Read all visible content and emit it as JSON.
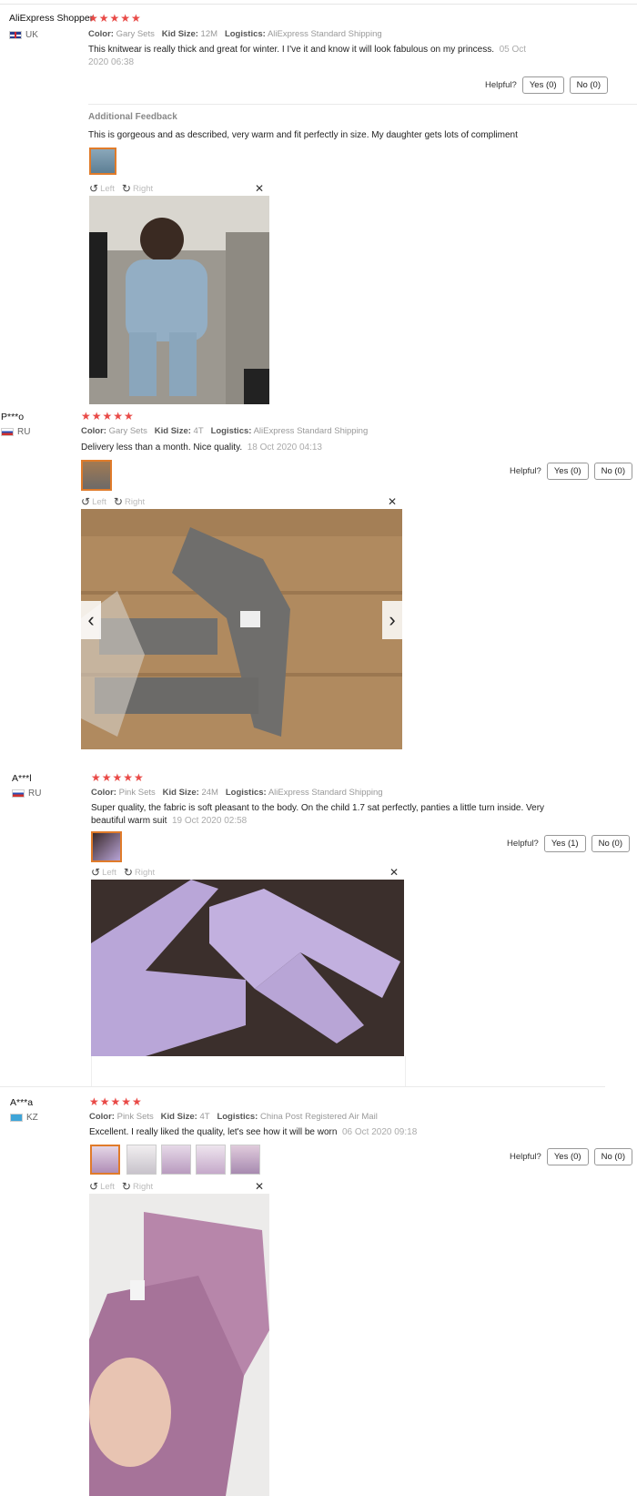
{
  "helpful_label": "Helpful?",
  "left_label": "Left",
  "right_label": "Right",
  "reviews": [
    {
      "user": "AliExpress Shopper",
      "country": "UK",
      "stars": "★★★★★",
      "color_label": "Color:",
      "color": "Gary Sets",
      "size_label": "Kid Size:",
      "size": "12M",
      "logistics_label": "Logistics:",
      "logistics": "AliExpress Standard Shipping",
      "text": "This knitwear is really thick and great for winter. I I've it and know it will look fabulous on my princess.",
      "date": "05 Oct 2020 06:38",
      "yes": "Yes (0)",
      "no": "No (0)",
      "additional_title": "Additional Feedback",
      "additional_text": "This is gorgeous and as described, very warm and fit perfectly in size. My daughter gets lots of compliment"
    },
    {
      "user": "P***o",
      "country": "RU",
      "stars": "★★★★★",
      "color_label": "Color:",
      "color": "Gary Sets",
      "size_label": "Kid Size:",
      "size": "4T",
      "logistics_label": "Logistics:",
      "logistics": "AliExpress Standard Shipping",
      "text": "Delivery less than a month. Nice quality.",
      "date": "18 Oct 2020 04:13",
      "yes": "Yes (0)",
      "no": "No (0)"
    },
    {
      "user": "A***l",
      "country": "RU",
      "stars": "★★★★★",
      "color_label": "Color:",
      "color": "Pink Sets",
      "size_label": "Kid Size:",
      "size": "24M",
      "logistics_label": "Logistics:",
      "logistics": "AliExpress Standard Shipping",
      "text": "Super quality, the fabric is soft pleasant to the body. On the child 1.7 sat perfectly, panties a little turn inside. Very beautiful warm suit",
      "date": "19 Oct 2020 02:58",
      "yes": "Yes (1)",
      "no": "No (0)"
    },
    {
      "user": "A***a",
      "country": "KZ",
      "stars": "★★★★★",
      "color_label": "Color:",
      "color": "Pink Sets",
      "size_label": "Kid Size:",
      "size": "4T",
      "logistics_label": "Logistics:",
      "logistics": "China Post Registered Air Mail",
      "text": "Excellent. I really liked the quality, let's see how it will be worn",
      "date": "06 Oct 2020 09:18",
      "yes": "Yes (0)",
      "no": "No (0)"
    }
  ],
  "icons": [
    "rotate-left-icon",
    "rotate-right-icon",
    "close-icon",
    "chevron-left-icon",
    "chevron-right-icon",
    "flag-icon",
    "star-icon"
  ],
  "colors": {
    "star": "#e94a47",
    "thumb_selected": "#e07b2a",
    "muted": "#999999"
  }
}
